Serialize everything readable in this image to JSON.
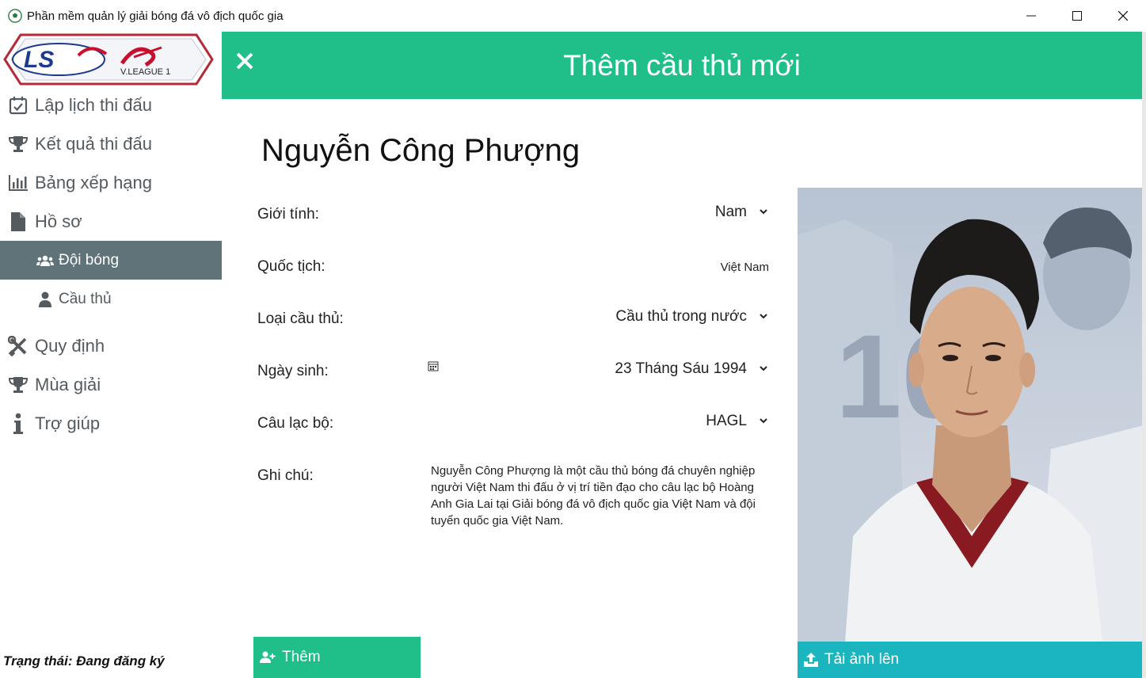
{
  "window": {
    "title": "Phần mềm quản lý giải bóng đá vô địch quốc gia"
  },
  "logo": {
    "brand": "LS",
    "league": "V.LEAGUE 1"
  },
  "sidebar": {
    "items": [
      {
        "label": "Lập lịch thi đấu",
        "icon": "calendar-check-icon"
      },
      {
        "label": "Kết quả thi đấu",
        "icon": "trophy-icon"
      },
      {
        "label": "Bảng xếp hạng",
        "icon": "bar-chart-icon"
      },
      {
        "label": "Hồ sơ",
        "icon": "file-icon"
      }
    ],
    "sub_items": [
      {
        "label": "Đội bóng",
        "icon": "users-icon",
        "active": true
      },
      {
        "label": "Cầu thủ",
        "icon": "user-icon",
        "active": false
      }
    ],
    "items_after": [
      {
        "label": "Quy định",
        "icon": "tools-icon"
      },
      {
        "label": "Mùa giải",
        "icon": "trophy-icon"
      },
      {
        "label": "Trợ giúp",
        "icon": "info-icon"
      }
    ],
    "status": "Trạng thái: Đang đăng ký"
  },
  "header": {
    "title": "Thêm cầu thủ mới"
  },
  "player": {
    "name": "Nguyễn Công Phượng"
  },
  "form": {
    "gender_label": "Giới tính:",
    "gender_value": "Nam",
    "nationality_label": "Quốc tịch:",
    "nationality_value": "Việt Nam",
    "type_label": "Loại cầu thủ:",
    "type_value": "Cầu thủ trong nước",
    "dob_label": "Ngày sinh:",
    "dob_value": "23 Tháng Sáu 1994",
    "club_label": "Câu lạc bộ:",
    "club_value": "HAGL",
    "notes_label": "Ghi chú:",
    "notes_value": "Nguyễn Công Phượng là một cầu thủ bóng đá chuyên nghiệp người Việt Nam thi đấu ở vị trí tiền đạo cho câu lạc bộ Hoàng Anh Gia Lai tại Giải bóng đá vô địch quốc gia Việt Nam và đội tuyển quốc gia Việt Nam."
  },
  "buttons": {
    "add_label": "Thêm",
    "upload_label": "Tải ảnh lên"
  },
  "colors": {
    "accent": "#20bf8a",
    "upload": "#1ab5bf",
    "active_nav": "#5f7379"
  }
}
